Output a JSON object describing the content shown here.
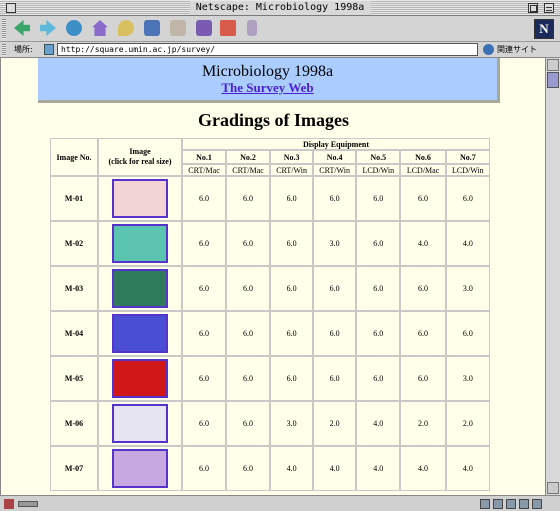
{
  "window": {
    "title": "Netscape: Microbiology 1998a"
  },
  "location": {
    "label": "場所:",
    "url": "http://square.umin.ac.jp/survey/",
    "related_label": "関連サイト"
  },
  "banner": {
    "title": "Microbiology 1998a",
    "link": "The Survey Web"
  },
  "page": {
    "heading": "Gradings of Images"
  },
  "table": {
    "col_image_no": "Image No.",
    "col_image_line1": "Image",
    "col_image_line2": "(click for real size)",
    "display_equipment": "Display Equipment",
    "equipment": [
      {
        "no": "No.1",
        "type": "CRT/Mac"
      },
      {
        "no": "No.2",
        "type": "CRT/Mac"
      },
      {
        "no": "No.3",
        "type": "CRT/Win"
      },
      {
        "no": "No.4",
        "type": "CRT/Win"
      },
      {
        "no": "No.5",
        "type": "LCD/Win"
      },
      {
        "no": "No.6",
        "type": "LCD/Mac"
      },
      {
        "no": "No.7",
        "type": "LCD/Win"
      }
    ],
    "rows": [
      {
        "id": "M-01",
        "grades": [
          "6.0",
          "6.0",
          "6.0",
          "6.0",
          "6.0",
          "6.0",
          "6.0"
        ],
        "thumb": "#f2d4d4"
      },
      {
        "id": "M-02",
        "grades": [
          "6.0",
          "6.0",
          "6.0",
          "3.0",
          "6.0",
          "4.0",
          "4.0"
        ],
        "thumb": "#5ac4b0"
      },
      {
        "id": "M-03",
        "grades": [
          "6.0",
          "6.0",
          "6.0",
          "6.0",
          "6.0",
          "6.0",
          "3.0"
        ],
        "thumb": "#2f7a5a"
      },
      {
        "id": "M-04",
        "grades": [
          "6.0",
          "6.0",
          "6.0",
          "6.0",
          "6.0",
          "6.0",
          "6.0"
        ],
        "thumb": "#4a4ed4"
      },
      {
        "id": "M-05",
        "grades": [
          "6.0",
          "6.0",
          "6.0",
          "6.0",
          "6.0",
          "6.0",
          "3.0"
        ],
        "thumb": "#d01818"
      },
      {
        "id": "M-06",
        "grades": [
          "6.0",
          "6.0",
          "3.0",
          "2.0",
          "4.0",
          "2.0",
          "2.0"
        ],
        "thumb": "#e6e4f2"
      },
      {
        "id": "M-07",
        "grades": [
          "6.0",
          "6.0",
          "4.0",
          "4.0",
          "4.0",
          "4.0",
          "4.0"
        ],
        "thumb": "#c8a8e0"
      }
    ]
  }
}
